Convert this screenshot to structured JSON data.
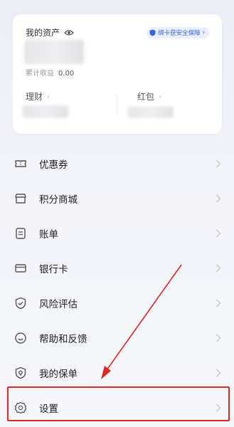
{
  "assets": {
    "title": "我的资产",
    "badge": "绑卡获安全保障",
    "earnings_label": "累计收益",
    "earnings_value": "0.00",
    "sub_left": "理财",
    "sub_right": "红包"
  },
  "menu": {
    "items": [
      {
        "label": "优惠券",
        "icon": "ticket-icon"
      },
      {
        "label": "积分商城",
        "icon": "store-icon"
      },
      {
        "label": "账单",
        "icon": "bill-icon"
      },
      {
        "label": "银行卡",
        "icon": "card-icon"
      },
      {
        "label": "风险评估",
        "icon": "shield-check-icon"
      },
      {
        "label": "帮助和反馈",
        "icon": "smile-icon"
      },
      {
        "label": "我的保单",
        "icon": "policy-icon"
      },
      {
        "label": "设置",
        "icon": "gear-icon"
      }
    ]
  },
  "annotation": {
    "color": "#e0262a",
    "highlighted_item": "设置"
  }
}
